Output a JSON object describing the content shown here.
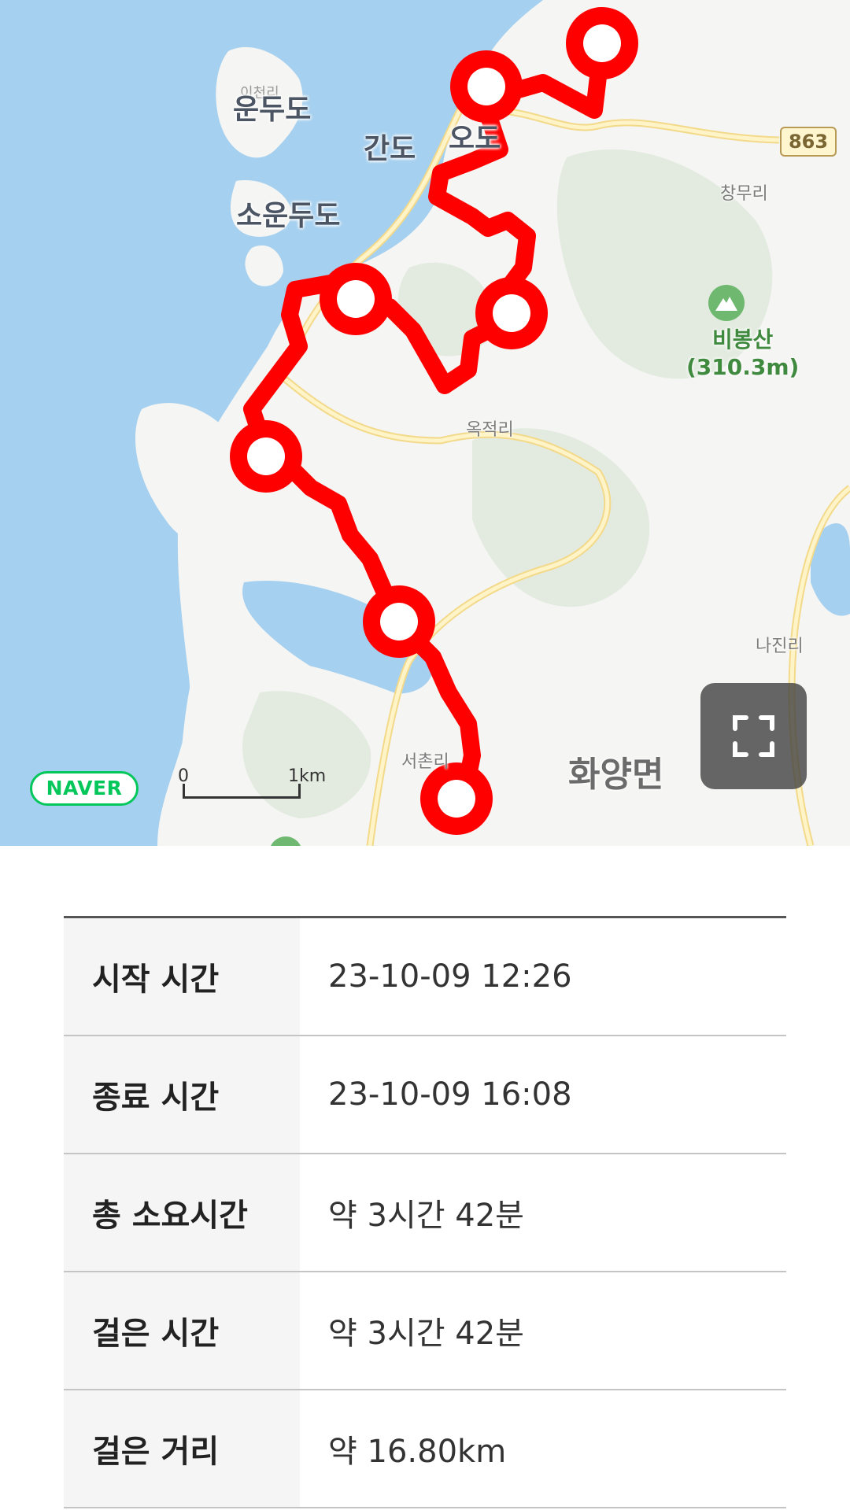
{
  "map": {
    "labels": {
      "icheolli": "이천리",
      "undudo": "운두도",
      "gando": "간도",
      "odo": "오도",
      "soundudo": "소운두도",
      "changmuri": "창무리",
      "okjeokri": "옥적리",
      "najinri": "나진리",
      "seochonri": "서촌리",
      "hwayangmyeon": "화양면"
    },
    "mountain": {
      "name": "비봉산",
      "height": "(310.3m)"
    },
    "road_number": "863",
    "provider_logo": "NAVER",
    "scale": {
      "zero": "0",
      "unit": "1km"
    },
    "route_color": "#ff0000",
    "water_color": "#a6d0ef",
    "icons": [
      "mountain-icon",
      "fullscreen-icon"
    ]
  },
  "info": {
    "rows": [
      {
        "label": "시작 시간",
        "value": "23-10-09 12:26"
      },
      {
        "label": "종료 시간",
        "value": "23-10-09 16:08"
      },
      {
        "label": "총 소요시간",
        "value": "약 3시간 42분"
      },
      {
        "label": "걸은 시간",
        "value": "약 3시간 42분"
      },
      {
        "label": "걸은 거리",
        "value": "약 16.80km"
      }
    ]
  }
}
